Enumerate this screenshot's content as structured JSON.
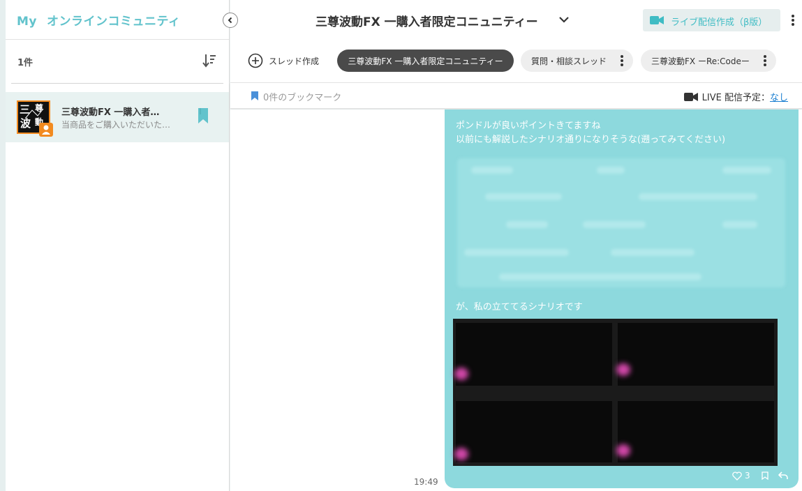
{
  "sidebar": {
    "brand_my": "My",
    "brand_name": "オンラインコミュニティ",
    "count": "1件",
    "communities": [
      {
        "title": "三尊波動FX 一購入者…",
        "subtitle": "当商品をご購入いただいた…",
        "avatar_text": [
          "三",
          "尊",
          "波",
          "動"
        ]
      }
    ]
  },
  "header": {
    "title": "三尊波動FX 一購入者限定コニュニティー",
    "live_button": "ライブ配信作成（β版）",
    "add_thread": "スレッド作成",
    "tabs": [
      {
        "label": "三尊波動FX 一購入者限定コニュニティー",
        "active": true
      },
      {
        "label": "質問・相談スレッド",
        "active": false
      },
      {
        "label": "三尊波動FX ーRe:Codeー",
        "active": false
      }
    ]
  },
  "bookmark_bar": {
    "bookmark_text": "0件のブックマーク",
    "live_schedule_label": "LIVE 配信予定：",
    "live_schedule_value": "なし"
  },
  "message": {
    "line1": "ポンドルが良いポイントきてますね",
    "line2": "以前にも解説したシナリオ通りになりそうな(遡ってみてください)",
    "line3": "が、私の立ててるシナリオです",
    "time": "19:49",
    "likes": "3"
  },
  "colors": {
    "accent": "#62c3cc",
    "bubble": "#8dd9dd",
    "avatar_border": "#f28a1f"
  }
}
